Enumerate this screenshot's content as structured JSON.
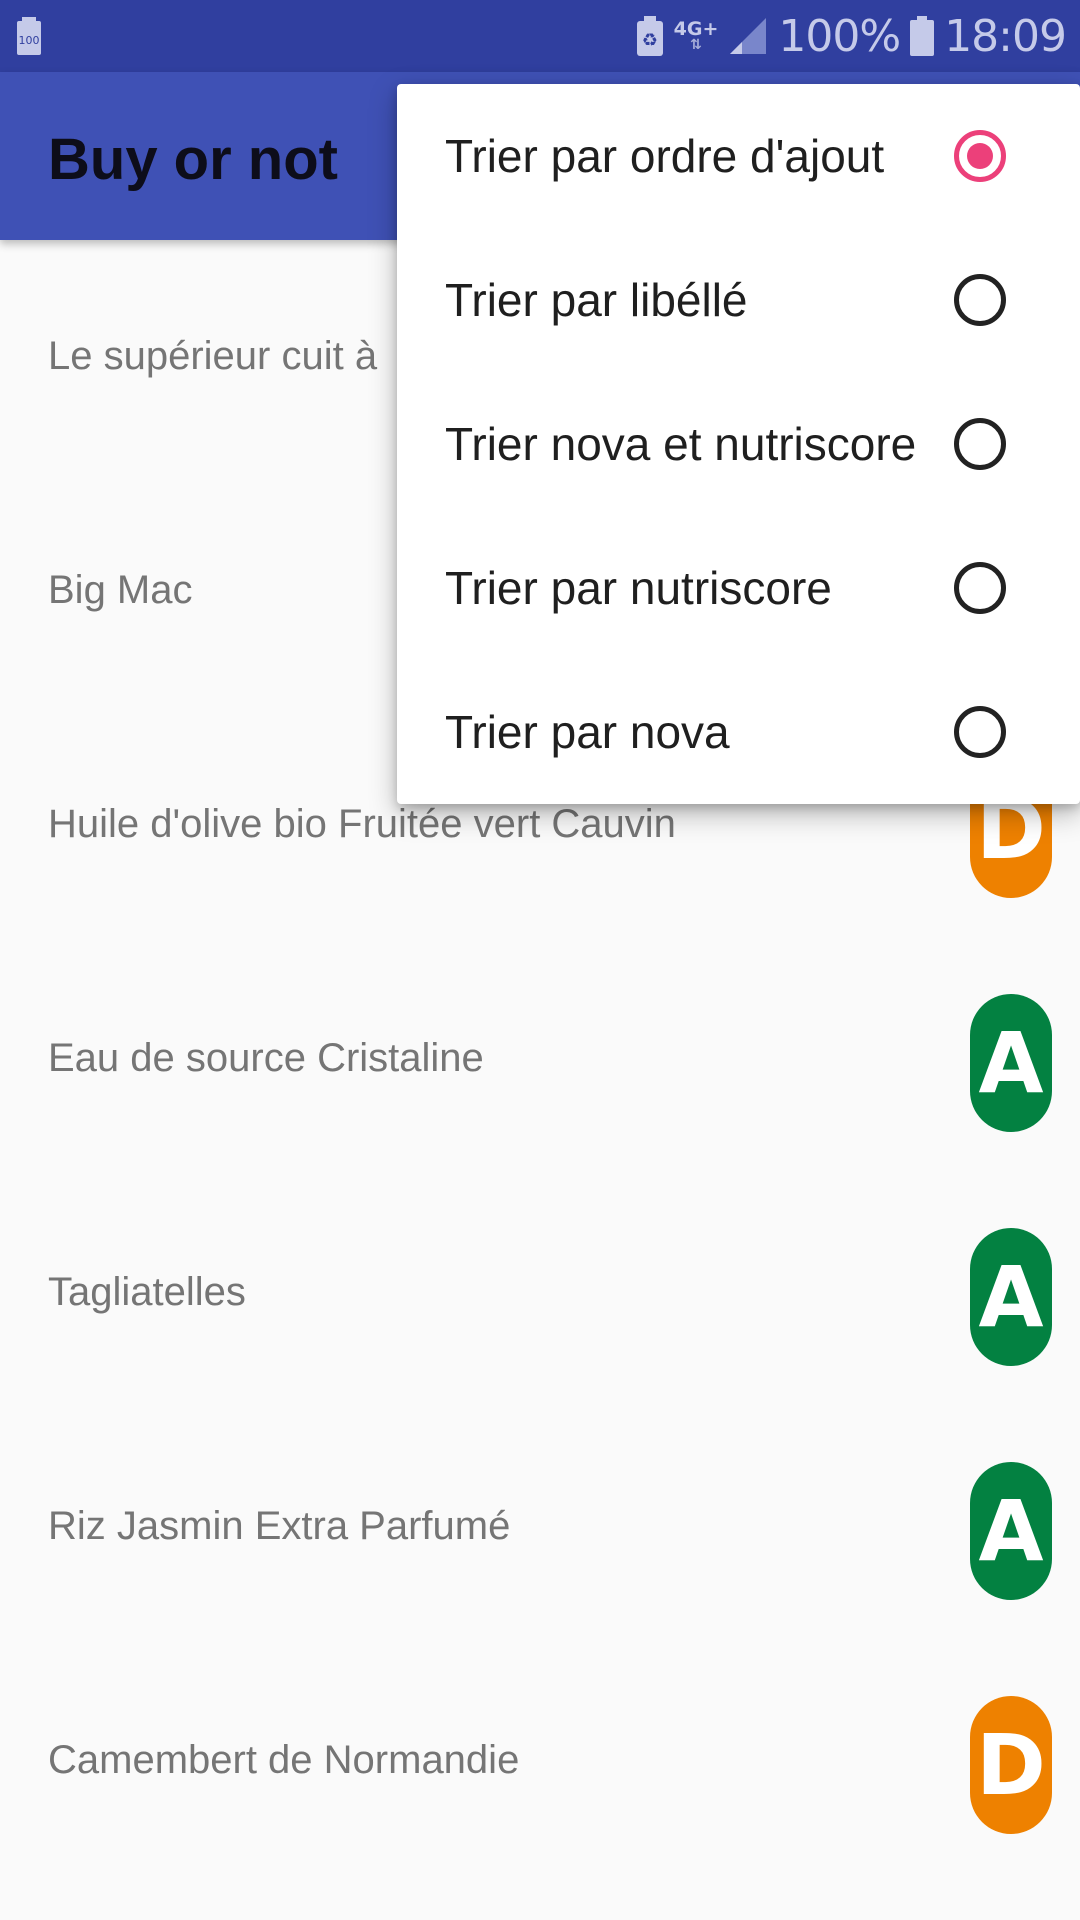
{
  "status_bar": {
    "left_icon": "battery-100-notification-icon",
    "left_icon_text": "100",
    "icons": [
      "recycle-icon",
      "network-4g-icon",
      "signal-icon",
      "battery-icon"
    ],
    "network_label": "4G+",
    "network_arrows": "⇅",
    "battery_percent": "100%",
    "time": "18:09"
  },
  "app_bar": {
    "title": "Buy or not"
  },
  "colors": {
    "status_bar": "#303f9f",
    "app_bar": "#3f51b5",
    "accent": "#ec407a",
    "score_A": "#038141",
    "score_D": "#ee8100"
  },
  "products": [
    {
      "name": "Le supérieur cuit à",
      "score": ""
    },
    {
      "name": "Big Mac",
      "score": ""
    },
    {
      "name": "Huile d'olive bio Fruitée vert Cauvin",
      "score": "D"
    },
    {
      "name": "Eau de source Cristaline",
      "score": "A"
    },
    {
      "name": "Tagliatelles",
      "score": "A"
    },
    {
      "name": "Riz Jasmin Extra Parfumé",
      "score": "A"
    },
    {
      "name": "Camembert de Normandie",
      "score": "D"
    }
  ],
  "sort_menu": {
    "items": [
      {
        "label": "Trier par ordre d'ajout",
        "checked": true
      },
      {
        "label": "Trier par libéllé",
        "checked": false
      },
      {
        "label": "Trier nova et nutriscore",
        "checked": false
      },
      {
        "label": "Trier par nutriscore",
        "checked": false
      },
      {
        "label": "Trier par nova",
        "checked": false
      }
    ]
  }
}
